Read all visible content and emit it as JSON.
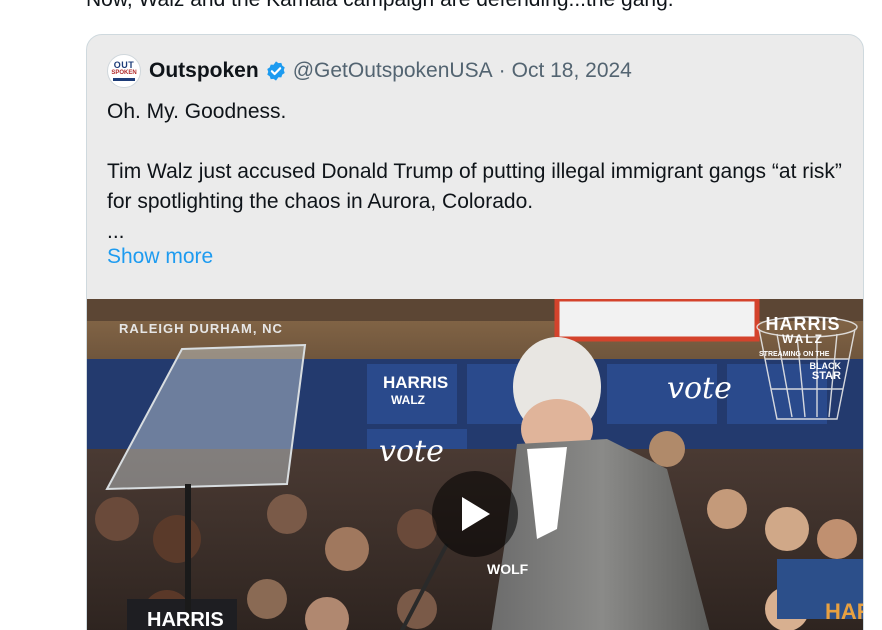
{
  "post": {
    "text_line": "Now, Walz and the Kamala campaign are defending...the gang."
  },
  "quoted": {
    "avatar_top": "OUT",
    "avatar_mid": "SPOKEN",
    "author_name": "Outspoken",
    "handle": "@GetOutspokenUSA",
    "separator": "·",
    "date": "Oct 18, 2024",
    "line1": "Oh. My. Goodness.",
    "line2": "Tim Walz just accused Donald Trump of putting illegal immigrant gangs “at risk” for spotlighting the chaos in Aurora, Colorado.",
    "ellipsis": "...",
    "show_more": "Show more"
  },
  "video": {
    "location": "RALEIGH DURHAM, NC",
    "brand_line1": "HARRIS",
    "brand_line2": "WALZ",
    "brand_line3": "STREAMING ON THE",
    "brand_line4": "BLACK",
    "brand_line5": "STAR",
    "sign_harris": "HARRIS",
    "sign_walz": "WALZ",
    "sign_vote": "vote",
    "shirt_text": "HARRIS",
    "partial_sign": "HAR",
    "partial_wolf": "WOLF",
    "colors": {
      "brand_blue": "#1d9bf0",
      "sign_blue": "#1f3a78",
      "backboard_red": "#d4432c"
    }
  }
}
